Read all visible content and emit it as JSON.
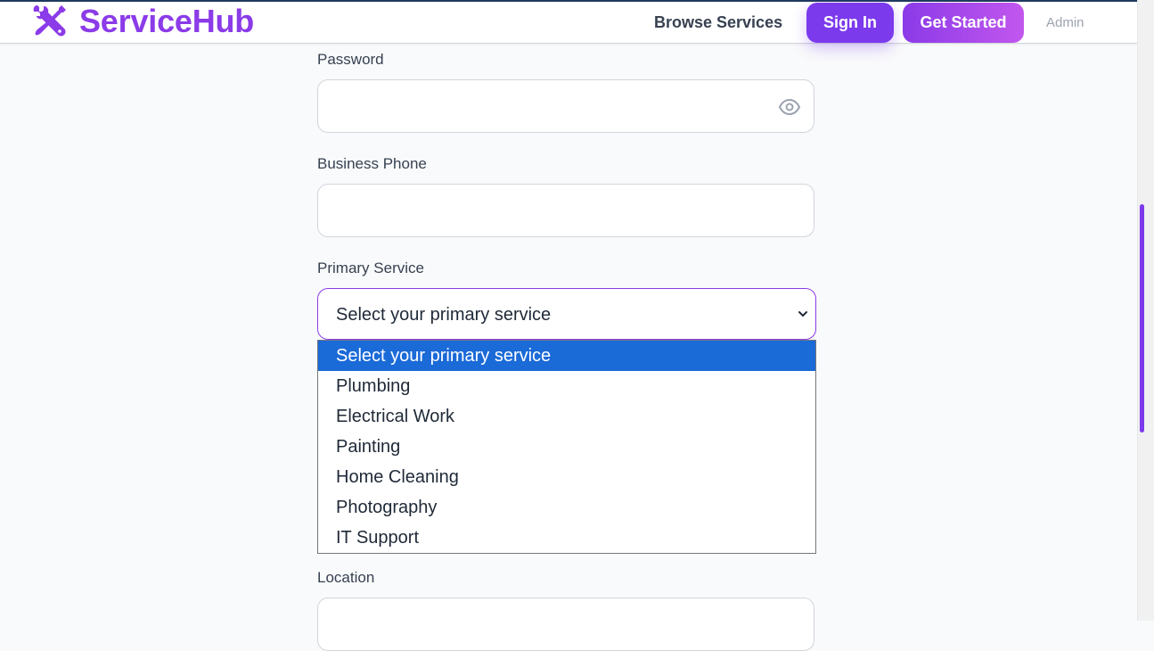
{
  "header": {
    "brand": "ServiceHub",
    "logo_icon": "tools-icon",
    "nav": {
      "browse": "Browse Services"
    },
    "sign_in": "Sign In",
    "get_started": "Get Started",
    "admin": "Admin",
    "accent_color": "#8b3be8"
  },
  "form": {
    "password": {
      "label": "Password",
      "value": "",
      "icon": "eye-icon"
    },
    "phone": {
      "label": "Business Phone",
      "value": ""
    },
    "primary_service": {
      "label": "Primary Service",
      "selected": "Select your primary service",
      "options": [
        "Select your primary service",
        "Plumbing",
        "Electrical Work",
        "Painting",
        "Home Cleaning",
        "Photography",
        "IT Support"
      ],
      "highlight_color": "#1a6ad8"
    },
    "location": {
      "label": "Location",
      "value": ""
    }
  }
}
